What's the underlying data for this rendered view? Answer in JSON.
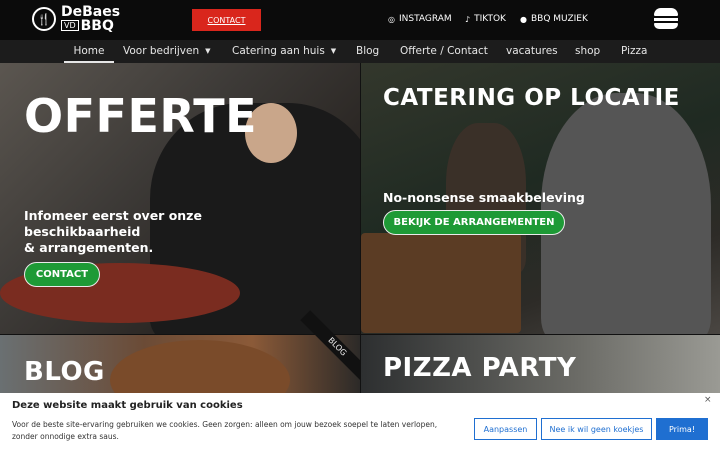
{
  "header": {
    "logo_line1": "DeBaes",
    "logo_vd": "VD",
    "logo_line2": "BBQ",
    "contact_label": "CONTACT",
    "social": [
      {
        "label": "INSTAGRAM",
        "icon": "instagram-icon"
      },
      {
        "label": "TIKTOK",
        "icon": "tiktok-icon"
      },
      {
        "label": "BBQ MUZIEK",
        "icon": "spotify-icon"
      }
    ],
    "burger_icon": "burger-icon"
  },
  "nav": {
    "items": [
      {
        "label": "Home",
        "active": true
      },
      {
        "label": "Voor bedrijven",
        "dropdown": true
      },
      {
        "label": "Catering aan huis",
        "dropdown": true
      },
      {
        "label": "Blog"
      },
      {
        "label": "Offerte / Contact"
      },
      {
        "label": "vacatures"
      },
      {
        "label": "shop"
      },
      {
        "label": "Pizza"
      }
    ]
  },
  "panels": {
    "offerte": {
      "heading": "OFFERTE",
      "text_line1": "Infomeer eerst over onze",
      "text_line2": "beschikbaarheid",
      "text_line3": "& arrangementen.",
      "button": "CONTACT"
    },
    "catering": {
      "heading": "CATERING OP LOCATIE",
      "subheading": "No-nonsense smaakbeleving",
      "button": "BEKIJK DE ARRANGEMENTEN"
    },
    "blog": {
      "heading": "BLOG",
      "ribbon": "BLOG"
    },
    "pizza": {
      "heading": "PIZZA PARTY"
    }
  },
  "cookie": {
    "title": "Deze website maakt gebruik van cookies",
    "text": "Voor de beste site-ervaring gebruiken we cookies. Geen zorgen: alleen om jouw bezoek soepel te laten verlopen, zonder onnodige extra saus.",
    "close": "×",
    "btn_adjust": "Aanpassen",
    "btn_decline": "Nee ik wil geen koekjes",
    "btn_accept": "Prima!"
  },
  "colors": {
    "brand_red": "#d9261c",
    "button_green": "#1e9a36",
    "cookie_blue": "#1f6fd1"
  }
}
